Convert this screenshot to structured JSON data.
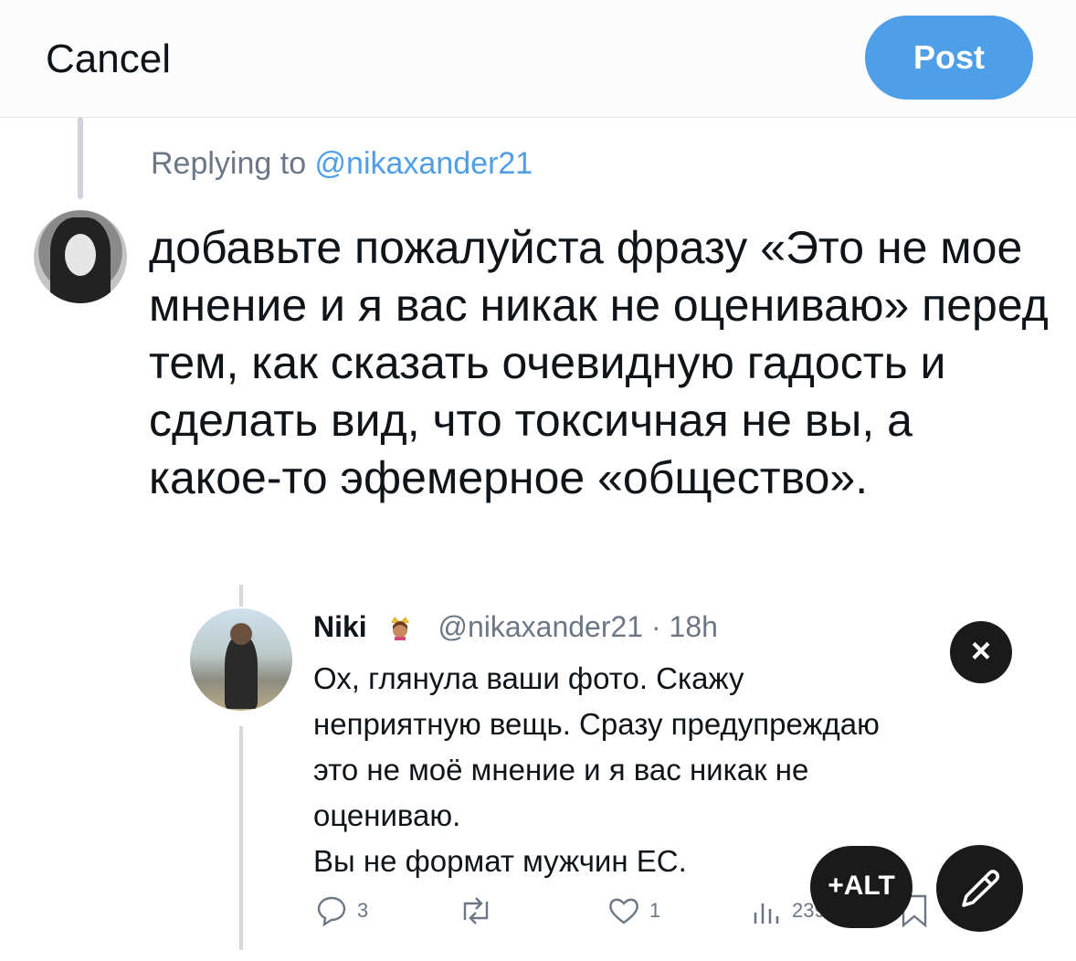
{
  "header": {
    "cancel_label": "Cancel",
    "post_label": "Post"
  },
  "reply": {
    "prefix": "Replying to ",
    "handle": "@nikaxander21"
  },
  "compose": {
    "text": "добавьте пожалуйста фразу «Это не мое мнение и я вас никак не оцениваю» перед тем, как сказать очевидную гадость и сделать вид, что токсичная не вы, а какое-то эфемерное «общество»."
  },
  "quoted_tweet": {
    "name": "Niki",
    "handle_time": "@nikaxander21 · 18h",
    "lines": [
      "Ох, глянула ваши фото. Скажу",
      "неприятную вещь. Сразу предупреждаю",
      "это не моё мнение и я вас никак не",
      "оцениваю.",
      "Вы не формат мужчин ЕС."
    ],
    "replies": "3",
    "likes": "1",
    "views": "239"
  },
  "buttons": {
    "close": "×",
    "alt": "+ALT"
  },
  "colors": {
    "accent": "#4f9ee8",
    "dark_button": "#1a1a1a",
    "secondary_text": "#6b7785"
  }
}
